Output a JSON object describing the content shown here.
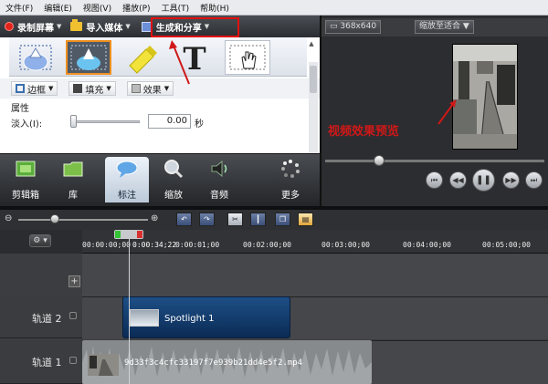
{
  "menu": [
    "文件(F)",
    "编辑(E)",
    "视图(V)",
    "播放(P)",
    "工具(T)",
    "帮助(H)"
  ],
  "toolbar": {
    "record": "录制屏幕",
    "import": "导入媒体",
    "produce": "生成和分享"
  },
  "callouts_panel": {
    "border_label": "边框",
    "fill_label": "填充",
    "effects_label": "效果",
    "text_tool_glyph": "T"
  },
  "properties": {
    "title": "属性",
    "fade_in_label": "淡入(I):",
    "fade_in_value": "0.00",
    "fade_in_unit": "秒"
  },
  "tabs": [
    {
      "label": "剪辑箱",
      "icon": "film-icon"
    },
    {
      "label": "库",
      "icon": "folder-icon"
    },
    {
      "label": "标注",
      "icon": "speech-bubble-icon"
    },
    {
      "label": "缩放",
      "icon": "magnifier-icon"
    },
    {
      "label": "音频",
      "icon": "speaker-icon"
    },
    {
      "label": "更多",
      "icon": "more-icon"
    }
  ],
  "preview": {
    "size_label": "368x640",
    "zoom_label": "缩放至适合",
    "annotation": "视频效果预览"
  },
  "timeline": {
    "playhead_time": "0:00:34;22",
    "ticks": [
      "00:00:00;00",
      "0:00:01;00",
      "00:02:00;00",
      "00:03:00;00",
      "00:04:00;00",
      "00:05:00;00"
    ],
    "tracks": [
      {
        "label": "轨道 2",
        "clip": "Spotlight 1"
      },
      {
        "label": "轨道 1",
        "clip": "9d33f3c4cfc33197f7e939b21dd4e5f2.mp4"
      }
    ]
  },
  "colors": {
    "highlight": "#e01010",
    "clip_blue": "#1d4f86",
    "annotation_red": "#d01818"
  }
}
